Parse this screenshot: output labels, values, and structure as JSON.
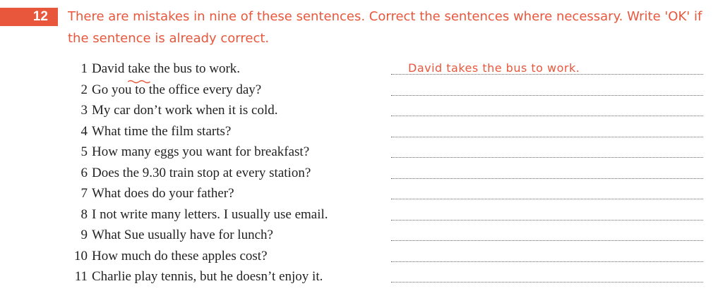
{
  "exercise": {
    "number": "12",
    "instructions": "There are mistakes in nine of these sentences. Correct the sentences where necessary. Write 'OK' if the sentence is already correct."
  },
  "items": [
    {
      "num": "1",
      "parts": [
        "David ",
        "take",
        " the bus to work."
      ],
      "answer": "David takes the bus to work."
    },
    {
      "num": "2",
      "sentence": "Go you to the office every day?",
      "answer": ""
    },
    {
      "num": "3",
      "sentence": "My car don’t work when it is cold.",
      "answer": ""
    },
    {
      "num": "4",
      "sentence": "What time the film starts?",
      "answer": ""
    },
    {
      "num": "5",
      "sentence": "How many eggs you want for breakfast?",
      "answer": ""
    },
    {
      "num": "6",
      "sentence": "Does the 9.30 train stop at every station?",
      "answer": ""
    },
    {
      "num": "7",
      "sentence": "What does do your father?",
      "answer": ""
    },
    {
      "num": "8",
      "sentence": "I not write many letters. I usually use email.",
      "answer": ""
    },
    {
      "num": "9",
      "sentence": "What Sue usually have for lunch?",
      "answer": ""
    },
    {
      "num": "10",
      "sentence": "How much do these apples cost?",
      "answer": ""
    },
    {
      "num": "11",
      "sentence": "Charlie play tennis, but he doesn’t enjoy it.",
      "answer": ""
    }
  ],
  "colors": {
    "accent": "#e8573c"
  }
}
